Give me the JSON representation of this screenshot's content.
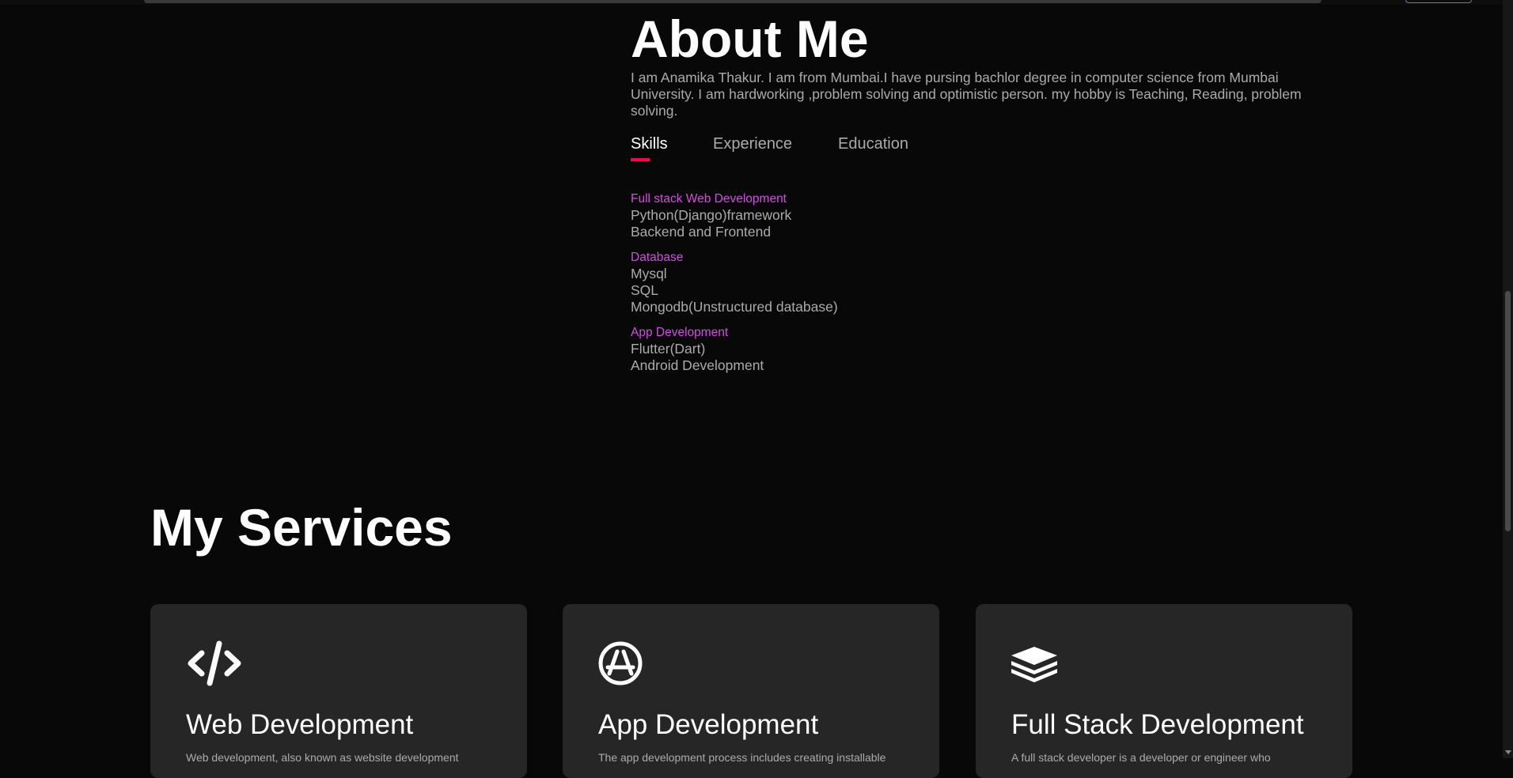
{
  "about": {
    "title": "About Me",
    "intro": "I am Anamika Thakur. I am from Mumbai.I have pursing bachlor degree in computer science from Mumbai University. I am hardworking ,problem solving and optimistic person. my hobby is Teaching, Reading, problem solving."
  },
  "tabs": [
    {
      "label": "Skills",
      "active": true
    },
    {
      "label": "Experience",
      "active": false
    },
    {
      "label": "Education",
      "active": false
    }
  ],
  "skills": [
    {
      "title": "Full stack Web Development",
      "items": [
        "Python(Django)framework",
        "Backend and Frontend"
      ]
    },
    {
      "title": "Database",
      "items": [
        "Mysql",
        "SQL",
        "Mongodb(Unstructured database)"
      ]
    },
    {
      "title": "App Development",
      "items": [
        "Flutter(Dart)",
        "Android Development"
      ]
    }
  ],
  "services": {
    "title": "My Services",
    "cards": [
      {
        "icon": "code-icon",
        "title": "Web Development",
        "desc": "Web development, also known as website development"
      },
      {
        "icon": "app-store-icon",
        "title": "App Development",
        "desc": "The app development process includes creating installable"
      },
      {
        "icon": "layers-icon",
        "title": "Full Stack Development",
        "desc": "A full stack developer is a developer or engineer who"
      }
    ]
  },
  "colors": {
    "background": "#080808",
    "accent": "#ff004f",
    "skill_title": "#d34ce3",
    "card": "#262626",
    "text": "#ababab"
  }
}
